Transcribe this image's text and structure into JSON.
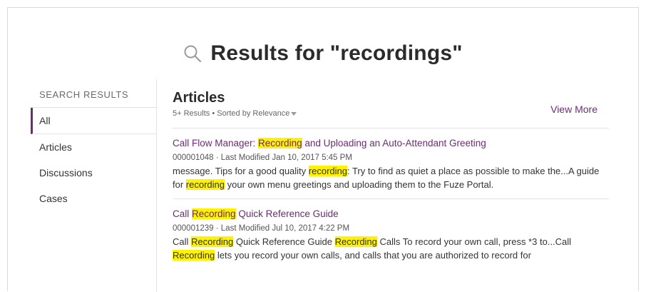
{
  "header": {
    "search_icon": "search-icon",
    "title_prefix": "Results for ",
    "title_query": "\"recordings\""
  },
  "sidebar": {
    "heading": "SEARCH RESULTS",
    "items": [
      {
        "label": "All",
        "active": true
      },
      {
        "label": "Articles"
      },
      {
        "label": "Discussions"
      },
      {
        "label": "Cases"
      }
    ]
  },
  "main": {
    "title": "Articles",
    "summary": "5+ Results • Sorted by Relevance",
    "view_more": "View More",
    "results": [
      {
        "title_parts": [
          "Call Flow Manager: ",
          "Recording",
          " and Uploading an Auto-Attendant Greeting"
        ],
        "meta": "000001048 · Last Modified Jan 10, 2017 5:45 PM",
        "snippet_parts": [
          "message. Tips for a good quality ",
          "recording",
          ": Try to find as quiet a place as possible to make the...A guide for ",
          "recording",
          " your own menu greetings and uploading them to the Fuze Portal."
        ]
      },
      {
        "title_parts": [
          "Call ",
          "Recording",
          " Quick Reference Guide"
        ],
        "meta": "000001239 · Last Modified Jul 10, 2017 4:22 PM",
        "snippet_parts": [
          "Call ",
          "Recording",
          " Quick Reference Guide ",
          "Recording",
          " Calls To record your own call, press *3 to...Call ",
          "Recording",
          " lets you record your own calls, and calls that you are authorized to record for"
        ]
      }
    ]
  },
  "colors": {
    "accent": "#6b2c74",
    "highlight": "#fff200"
  }
}
